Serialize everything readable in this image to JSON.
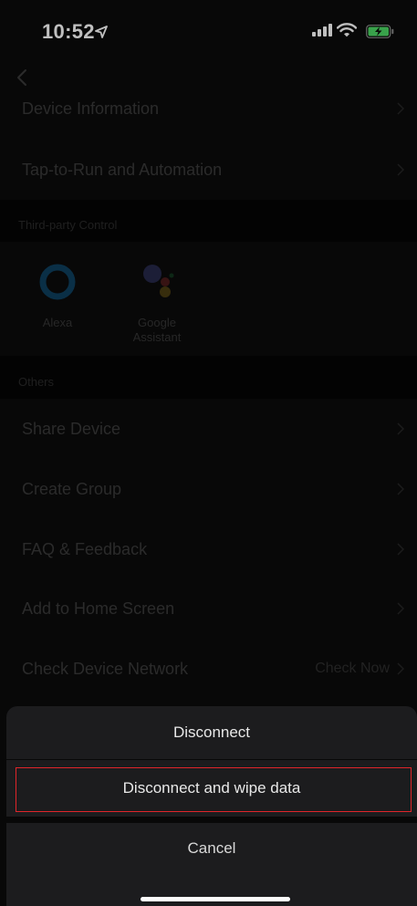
{
  "status_bar": {
    "time": "10:52"
  },
  "rows_top": [
    {
      "label": "Device Information"
    },
    {
      "label": "Tap-to-Run and Automation"
    }
  ],
  "third_party": {
    "header": "Third-party Control",
    "items": [
      {
        "label": "Alexa",
        "icon": "alexa-icon"
      },
      {
        "label_line1": "Google",
        "label_line2": "Assistant",
        "icon": "google-assistant-icon"
      }
    ]
  },
  "others": {
    "header": "Others",
    "rows": [
      {
        "label": "Share Device"
      },
      {
        "label": "Create Group"
      },
      {
        "label": "FAQ & Feedback"
      },
      {
        "label": "Add to Home Screen"
      },
      {
        "label": "Check Device Network",
        "value": "Check Now"
      }
    ]
  },
  "action_sheet": {
    "option1": "Disconnect",
    "option2": "Disconnect and wipe data",
    "cancel": "Cancel"
  },
  "colors": {
    "highlight": "#e0252a",
    "sheet_bg": "#1c1c1e"
  }
}
